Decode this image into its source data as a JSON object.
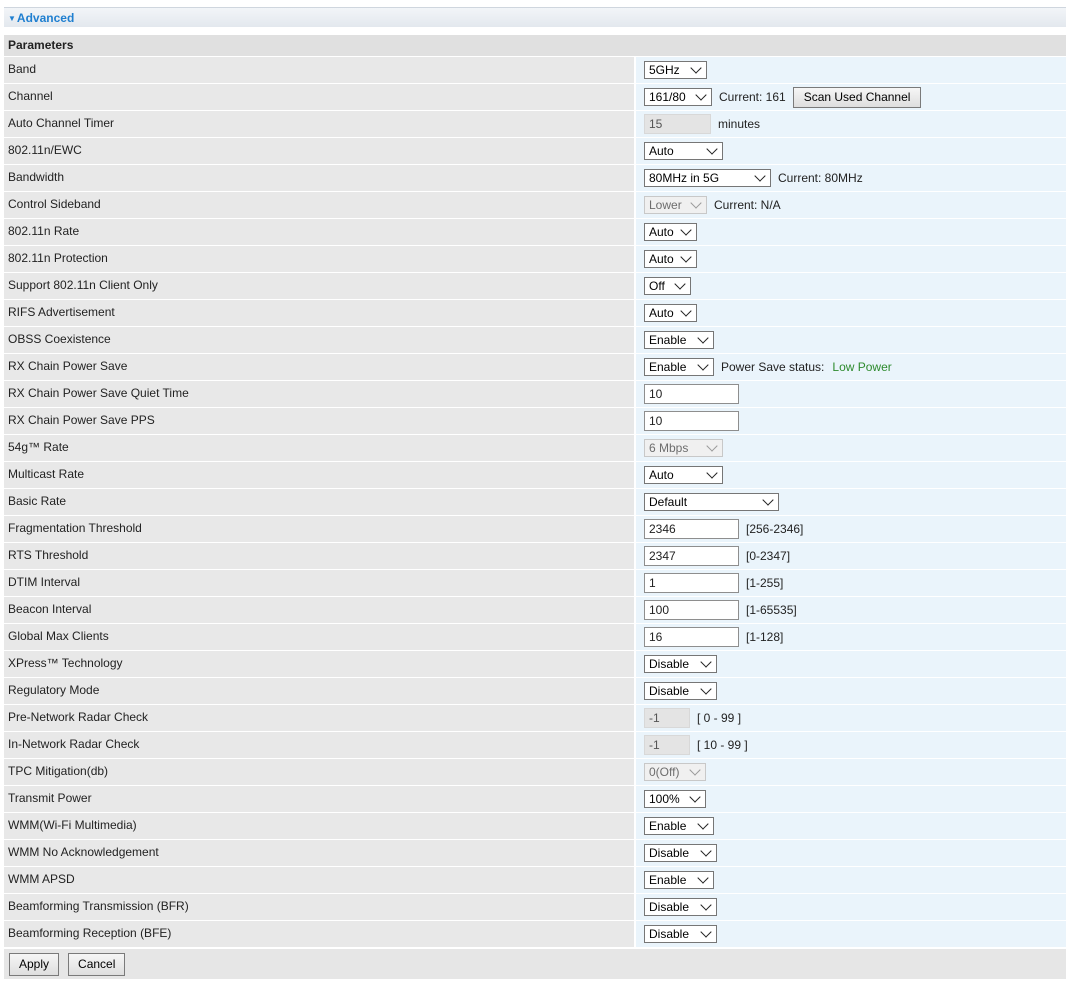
{
  "section": {
    "title": "Advanced",
    "params_title": "Parameters"
  },
  "rows": {
    "band": {
      "label": "Band",
      "value": "5GHz"
    },
    "channel": {
      "label": "Channel",
      "value": "161/80",
      "current": "Current: 161",
      "scan_button": "Scan Used Channel"
    },
    "auto_channel_timer": {
      "label": "Auto Channel Timer",
      "value": "15",
      "unit": "minutes"
    },
    "n_ewc": {
      "label": "802.11n/EWC",
      "value": "Auto"
    },
    "bandwidth": {
      "label": "Bandwidth",
      "value": "80MHz in 5G",
      "current": "Current: 80MHz"
    },
    "control_sideband": {
      "label": "Control Sideband",
      "value": "Lower",
      "current": "Current: N/A"
    },
    "n_rate": {
      "label": "802.11n Rate",
      "value": "Auto"
    },
    "n_protection": {
      "label": "802.11n Protection",
      "value": "Auto"
    },
    "n_client_only": {
      "label": "Support 802.11n Client Only",
      "value": "Off"
    },
    "rifs": {
      "label": "RIFS Advertisement",
      "value": "Auto"
    },
    "obss": {
      "label": "OBSS Coexistence",
      "value": "Enable"
    },
    "rx_power_save": {
      "label": "RX Chain Power Save",
      "value": "Enable",
      "status_label": "Power Save status:",
      "status_value": "Low Power"
    },
    "rx_quiet_time": {
      "label": "RX Chain Power Save Quiet Time",
      "value": "10"
    },
    "rx_pps": {
      "label": "RX Chain Power Save PPS",
      "value": "10"
    },
    "rate_54g": {
      "label": "54g™ Rate",
      "value": "6 Mbps"
    },
    "multicast_rate": {
      "label": "Multicast Rate",
      "value": "Auto"
    },
    "basic_rate": {
      "label": "Basic Rate",
      "value": "Default"
    },
    "frag_threshold": {
      "label": "Fragmentation Threshold",
      "value": "2346",
      "range": "[256-2346]"
    },
    "rts_threshold": {
      "label": "RTS Threshold",
      "value": "2347",
      "range": "[0-2347]"
    },
    "dtim": {
      "label": "DTIM Interval",
      "value": "1",
      "range": "[1-255]"
    },
    "beacon": {
      "label": "Beacon Interval",
      "value": "100",
      "range": "[1-65535]"
    },
    "max_clients": {
      "label": "Global Max Clients",
      "value": "16",
      "range": "[1-128]"
    },
    "xpress": {
      "label": "XPress™ Technology",
      "value": "Disable"
    },
    "regulatory": {
      "label": "Regulatory Mode",
      "value": "Disable"
    },
    "pre_radar": {
      "label": "Pre-Network Radar Check",
      "value": "-1",
      "range": "[ 0 - 99 ]"
    },
    "in_radar": {
      "label": "In-Network Radar Check",
      "value": "-1",
      "range": "[ 10 - 99 ]"
    },
    "tpc": {
      "label": "TPC Mitigation(db)",
      "value": "0(Off)"
    },
    "tx_power": {
      "label": "Transmit Power",
      "value": "100%"
    },
    "wmm": {
      "label": "WMM(Wi-Fi Multimedia)",
      "value": "Enable"
    },
    "wmm_noack": {
      "label": "WMM No Acknowledgement",
      "value": "Disable"
    },
    "wmm_apsd": {
      "label": "WMM APSD",
      "value": "Enable"
    },
    "bfr": {
      "label": "Beamforming Transmission (BFR)",
      "value": "Disable"
    },
    "bfe": {
      "label": "Beamforming Reception (BFE)",
      "value": "Disable"
    }
  },
  "footer": {
    "apply": "Apply",
    "cancel": "Cancel"
  },
  "colors": {
    "accent": "#1f7fd0",
    "status_green": "#2e8b2e"
  }
}
